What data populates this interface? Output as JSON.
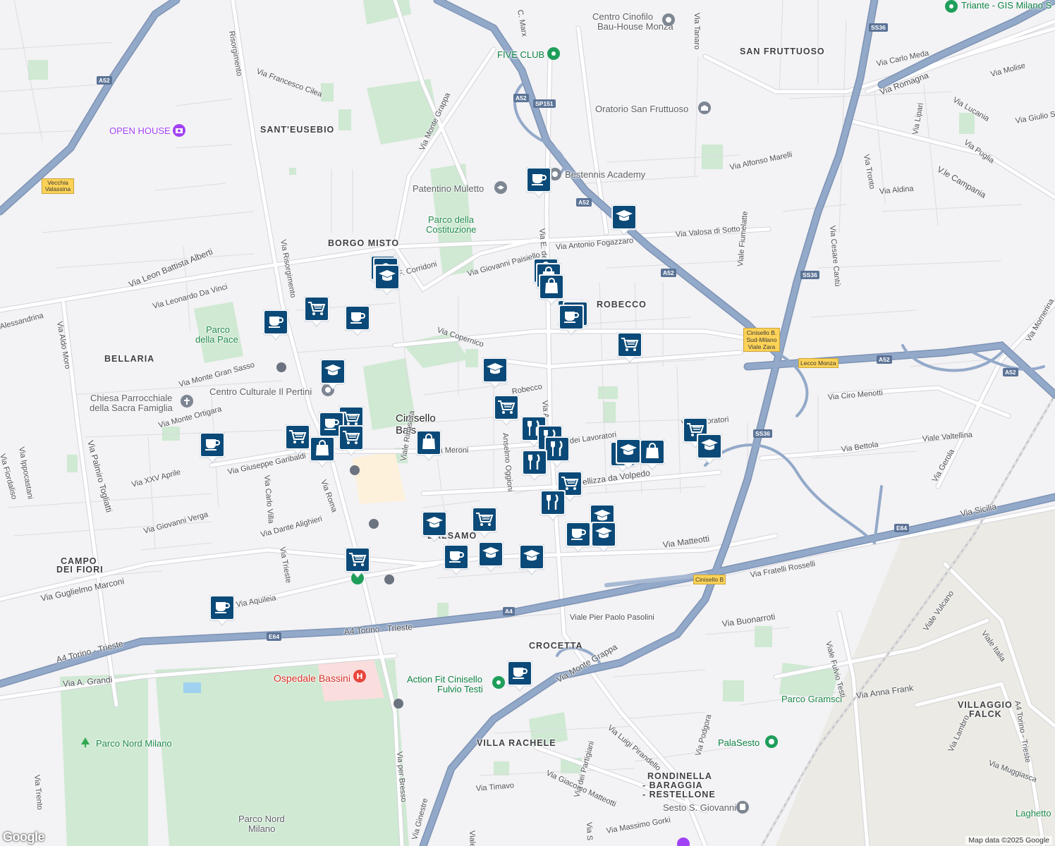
{
  "map": {
    "attribution": "Map data ©2025 Google",
    "logo": "Google",
    "colors": {
      "background": "#f3f2f4",
      "road": "#ffffff",
      "highway": "#8ea4c4",
      "highway_dark": "#7d93b5",
      "park": "#cfe9d3",
      "marker": "#0b4a78"
    }
  },
  "districts": [
    {
      "name": "SANT'EUSEBIO"
    },
    {
      "name": "BORGO MISTO"
    },
    {
      "name": "BELLARIA"
    },
    {
      "name": "SAN FRUTTUOSO"
    },
    {
      "name": "ROBECCO"
    },
    {
      "name": "CAMPO"
    },
    {
      "name": "DEI FIORI"
    },
    {
      "name": "BALSAMO"
    },
    {
      "name": "CROCETTA"
    },
    {
      "name": "VILLA RACHELE"
    },
    {
      "name": "VILLAGGIO"
    },
    {
      "name": "FALCK"
    },
    {
      "name": "RONDINELLA"
    },
    {
      "name": "- BARAGGIA"
    },
    {
      "name": "- RESTELLONE"
    }
  ],
  "places": [
    {
      "name": "Cinisello",
      "type": "city"
    },
    {
      "name": "Bals",
      "type": "city"
    },
    {
      "name": "OPEN HOUSE",
      "type": "purple"
    },
    {
      "name": "FIVE CLUB",
      "type": "teal"
    },
    {
      "name": "Centro Cinofilo",
      "type": "poi"
    },
    {
      "name": "Bau-House Monza",
      "type": "poi"
    },
    {
      "name": "Triante - GIS Milano S",
      "type": "teal"
    },
    {
      "name": "Oratorio San Fruttuoso",
      "type": "poi"
    },
    {
      "name": "Bestennis Academy",
      "type": "poi"
    },
    {
      "name": "Patentino Muletto",
      "type": "poi"
    },
    {
      "name": "Parco della",
      "type": "park"
    },
    {
      "name": "Costituzione",
      "type": "park"
    },
    {
      "name": "Parco",
      "type": "park"
    },
    {
      "name": "della Pace",
      "type": "park"
    },
    {
      "name": "Centro Culturale Il Pertini",
      "type": "poi"
    },
    {
      "name": "Chiesa Parrocchiale",
      "type": "poi"
    },
    {
      "name": "della Sacra Famiglia",
      "type": "poi"
    },
    {
      "name": "Ospedale Bassini",
      "type": "red"
    },
    {
      "name": "Action Fit Cinisello",
      "type": "teal"
    },
    {
      "name": "Fulvio Testi",
      "type": "teal"
    },
    {
      "name": "Parco Nord Milano",
      "type": "park"
    },
    {
      "name": "Parco Nord",
      "type": "poi"
    },
    {
      "name": "Milano",
      "type": "poi"
    },
    {
      "name": "Parco Gramsci",
      "type": "park"
    },
    {
      "name": "PalaSesto",
      "type": "teal"
    },
    {
      "name": "Sesto S. Giovanni",
      "type": "poi"
    },
    {
      "name": "Laghetto",
      "type": "park"
    }
  ],
  "streets": [
    "Risorgimento",
    "Via Francesco Cilea",
    "Via Monte Grappa",
    "C. Marx",
    "Via Tanaro",
    "Via Carlo Meda",
    "Via Romagna",
    "Via Molise",
    "Via Lucania",
    "Via Giulio S",
    "Via Puglia",
    "Via Lipari",
    "Via Tronto",
    "Via Aldina",
    "V.le Campania",
    "Via Alfonso Marelli",
    "Via Valosa di Sotto",
    "Via Antonio Fogazzaro",
    "Via Giovanni Paisiello",
    "F. Corridoni",
    "Via Leon Battista Alberti",
    "Via Leonardo Da Vinci",
    "Via Risorgimento",
    "Alessandrina",
    "Via Aldo Moro",
    "Via Copernico",
    "Via Monte Gran Sasso",
    "Via Monte Ortigara",
    "Via Palmiro Togliatti",
    "Via Ippocastani",
    "Via Fiordaliso",
    "Via XXV Aprile",
    "Via Giuseppe Garibaldi",
    "Via Carlo Villa",
    "Via Roma",
    "Via Giovanni Verga",
    "Via Dante Alighieri",
    "Via Trieste",
    "Via Guglielmo Marconi",
    "Via Aquileia",
    "Via Meroni",
    "Viale Rinascita",
    "Anselmo Oggioni",
    "Robecco",
    "Via E. de",
    "Via A",
    "dei Lavoratori",
    "Via Lavoratori",
    "Pellizza da Volpedo",
    "Via Matteotti",
    "Via Ciro Menotti",
    "Via Bettola",
    "Viale Valtellina",
    "Via Gerola",
    "Via Mornerina",
    "Viale Fiumelatte",
    "Via Cesare Cantù",
    "Via Fratelli Rosselli",
    "Viale Pier Paolo Pasolini",
    "Via Buonarroti",
    "Viale Fulvio Testi",
    "Via Monte Grappa",
    "Via Luigi Pirandello",
    "Via Podgora",
    "Via Giacomo Matteotti",
    "Via dei Partigiani",
    "Via Timavo",
    "Via Massimo Gorki",
    "Via per Bresso",
    "Via A. Grandi",
    "Via Trento",
    "Via Anna Frank",
    "Viale Vulcano",
    "Viale Italia",
    "Via Lambro",
    "Via Muggiasca",
    "A4 Torino - Trieste",
    "A4 Torino - Trieste",
    "A4 Torino - Trieste",
    "Via Sicilia",
    "Via S",
    "Viale Testi",
    "Via Ginestre"
  ],
  "road_shields": [
    "A52",
    "A52",
    "A52",
    "A52",
    "A52",
    "A52",
    "SP151",
    "SS36",
    "SS36",
    "SS36",
    "E64",
    "E64",
    "A4"
  ],
  "exit_signs": [
    "Vecchia Valassina",
    "Cinisello B. Sud-Milano Viale Zara",
    "Lecco Monza",
    "Cinisello B"
  ],
  "markers": [
    {
      "icon": "cafe"
    },
    {
      "icon": "school"
    },
    {
      "icon": "school"
    },
    {
      "icon": "school"
    },
    {
      "icon": "school"
    },
    {
      "icon": "shopping"
    },
    {
      "icon": "shopping"
    },
    {
      "icon": "shopping"
    },
    {
      "icon": "shopping"
    },
    {
      "icon": "shopping"
    },
    {
      "icon": "cafe"
    },
    {
      "icon": "grocery"
    },
    {
      "icon": "cafe"
    },
    {
      "icon": "school"
    },
    {
      "icon": "school"
    },
    {
      "icon": "grocery"
    },
    {
      "icon": "grocery"
    },
    {
      "icon": "cafe"
    },
    {
      "icon": "grocery"
    },
    {
      "icon": "cafe"
    },
    {
      "icon": "grocery"
    },
    {
      "icon": "cafe"
    },
    {
      "icon": "shopping"
    },
    {
      "icon": "grocery"
    },
    {
      "icon": "restaurant"
    },
    {
      "icon": "restaurant"
    },
    {
      "icon": "restaurant"
    },
    {
      "icon": "restaurant"
    },
    {
      "icon": "grocery"
    },
    {
      "icon": "restaurant"
    },
    {
      "icon": "restaurant"
    },
    {
      "icon": "shopping"
    },
    {
      "icon": "grocery"
    },
    {
      "icon": "school"
    },
    {
      "icon": "school"
    },
    {
      "icon": "grocery"
    },
    {
      "icon": "school"
    },
    {
      "icon": "cafe"
    },
    {
      "icon": "school"
    },
    {
      "icon": "school"
    },
    {
      "icon": "cafe"
    },
    {
      "icon": "school"
    },
    {
      "icon": "school"
    },
    {
      "icon": "grocery"
    },
    {
      "icon": "cafe"
    },
    {
      "icon": "cafe"
    },
    {
      "icon": "shopping"
    }
  ]
}
